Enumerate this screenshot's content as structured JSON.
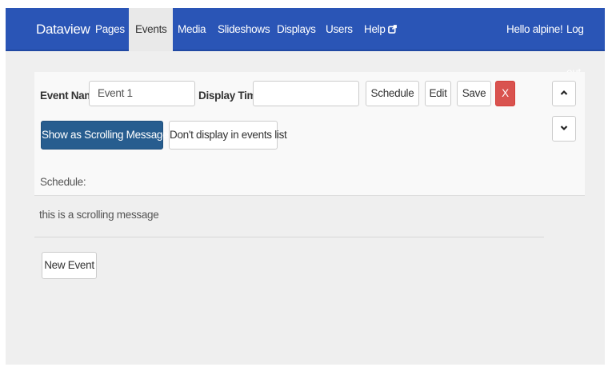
{
  "nav": {
    "brand": "Dataview",
    "items": [
      {
        "label": "Pages",
        "active": false
      },
      {
        "label": "Events",
        "active": true
      },
      {
        "label": "Media",
        "active": false
      },
      {
        "label": "Slideshows",
        "active": false
      },
      {
        "label": "Displays",
        "active": false
      },
      {
        "label": "Users",
        "active": false
      },
      {
        "label": "Help",
        "active": false,
        "icon": "external-link-icon"
      }
    ],
    "greeting": "Hello alpine!",
    "logout": "Log out"
  },
  "event": {
    "name_label": "Event Name",
    "name_value": "Event 1",
    "display_time_label": "Display Time",
    "display_time_value": "",
    "schedule_button": "Schedule",
    "edit_button": "Edit",
    "save_button": "Save",
    "delete_button": "X",
    "scrolling_button": "Show as Scrolling Message",
    "hide_list_button": "Don't display in events list",
    "schedule_text": "Schedule:",
    "up_icon": "chevron-up-icon",
    "down_icon": "chevron-down-icon"
  },
  "message": "this  is a scrolling message",
  "new_event_button": "New Event",
  "colors": {
    "navbar": "#2a55b6",
    "primary": "#275d8f",
    "danger": "#d9534f",
    "background": "#efefef"
  }
}
